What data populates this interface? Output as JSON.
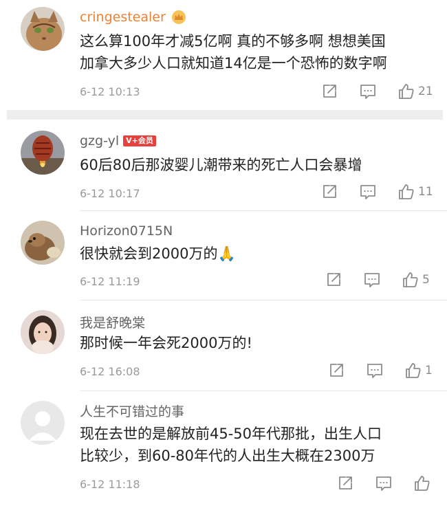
{
  "comments": [
    {
      "username": "cringestealer",
      "text_lines": [
        "这么算100年才减5亿啊 真的不够多啊 想想美国",
        "加拿大多少人口就知道14亿是一个恐怖的数字啊"
      ],
      "time": "6-12 10:13",
      "likes": "21"
    },
    {
      "username": "gzg-yl",
      "badge": "V+会员",
      "text_lines": [
        "60后80后那波婴儿潮带来的死亡人口会暴增"
      ],
      "time": "6-12 10:17",
      "likes": "11"
    },
    {
      "username": "Horizon0715N",
      "text_lines": [
        "很快就会到2000万的🙏"
      ],
      "time": "6-12 11:19",
      "likes": "5"
    },
    {
      "username": "我是舒晚棠",
      "text_lines": [
        "那时候一年会死2000万的!"
      ],
      "time": "6-12 16:08",
      "likes": "1"
    },
    {
      "username": "人生不可错过的事",
      "text_lines": [
        "现在去世的是解放前45-50年代那批，出生人口",
        "比较少，到60-80年代的人出生大概在2300万"
      ],
      "time": "6-12 11:18",
      "likes": ""
    }
  ],
  "icons": {
    "share": "share-icon",
    "comment": "comment-icon",
    "like": "thumbs-up-icon"
  },
  "colors": {
    "vip_name": "#f08032",
    "badge": "#e8403c",
    "text": "#222222",
    "meta": "#9a9a9a"
  }
}
